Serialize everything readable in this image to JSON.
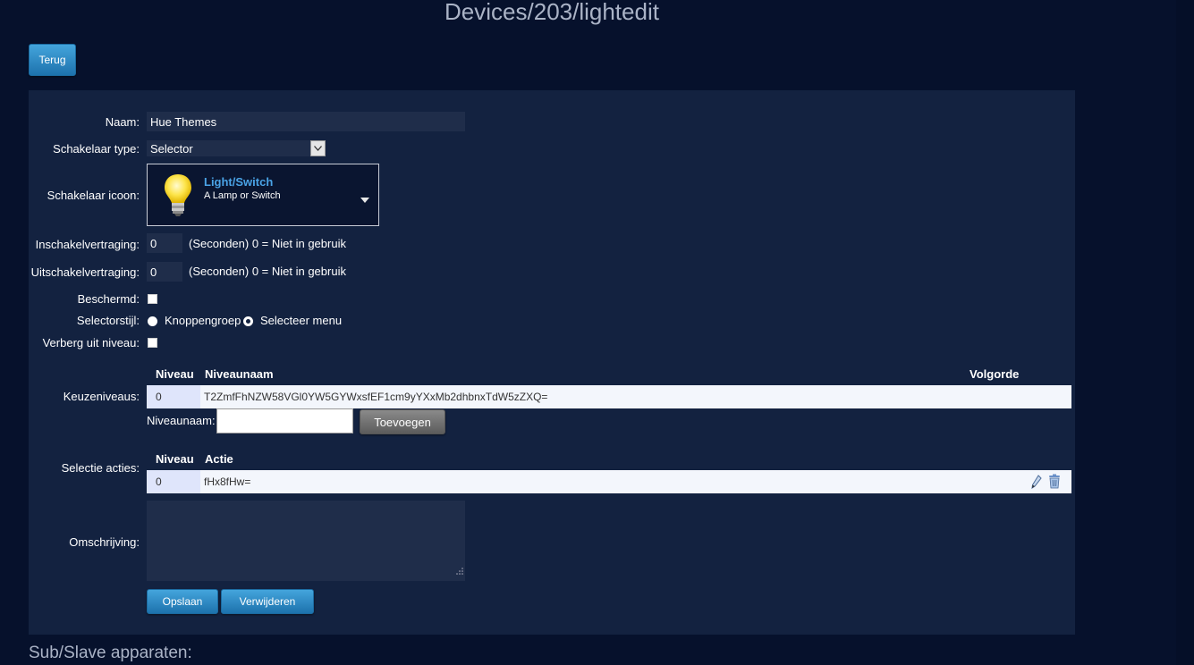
{
  "page": {
    "title": "Devices/203/lightedit"
  },
  "header": {
    "back_label": "Terug"
  },
  "form": {
    "name_label": "Naam:",
    "name_value": "Hue Themes",
    "switch_type_label": "Schakelaar type:",
    "switch_type_value": "Selector",
    "switch_icon_label": "Schakelaar icoon:",
    "icon_title": "Light/Switch",
    "icon_subtitle": "A Lamp or Switch",
    "on_delay_label": "Inschakelvertraging:",
    "on_delay_value": "0",
    "on_delay_hint": "(Seconden) 0 = Niet in gebruik",
    "off_delay_label": "Uitschakelvertraging:",
    "off_delay_value": "0",
    "off_delay_hint": "(Seconden) 0 = Niet in gebruik",
    "protected_label": "Beschermd:",
    "selector_style_label": "Selectorstijl:",
    "style_option_buttons": "Knoppengroep",
    "style_option_menu": "Selecteer menu",
    "hide_off_label": "Verberg uit niveau:",
    "levels_label": "Keuzeniveaus:",
    "levels_header": {
      "level": "Niveau",
      "name": "Niveaunaam",
      "order": "Volgorde"
    },
    "levels_rows": [
      {
        "level": "0",
        "name": "T2ZmfFhNZW58VGl0YW5GYWxsfEF1cm9yYXxMb2dhbnxTdW5zZXQ="
      }
    ],
    "level_name_label": "Niveaunaam:",
    "add_label": "Toevoegen",
    "actions_label": "Selectie acties:",
    "actions_header": {
      "level": "Niveau",
      "action": "Actie"
    },
    "actions_rows": [
      {
        "level": "0",
        "action": "fHx8fHw="
      }
    ],
    "description_label": "Omschrijving:",
    "save_label": "Opslaan",
    "delete_label": "Verwijderen"
  },
  "sub": {
    "title": "Sub/Slave apparaten:"
  },
  "colors": {
    "background": "#06112c",
    "panel": "#132240",
    "button_blue": "#2a8cc8",
    "field": "#1f2d4a"
  }
}
